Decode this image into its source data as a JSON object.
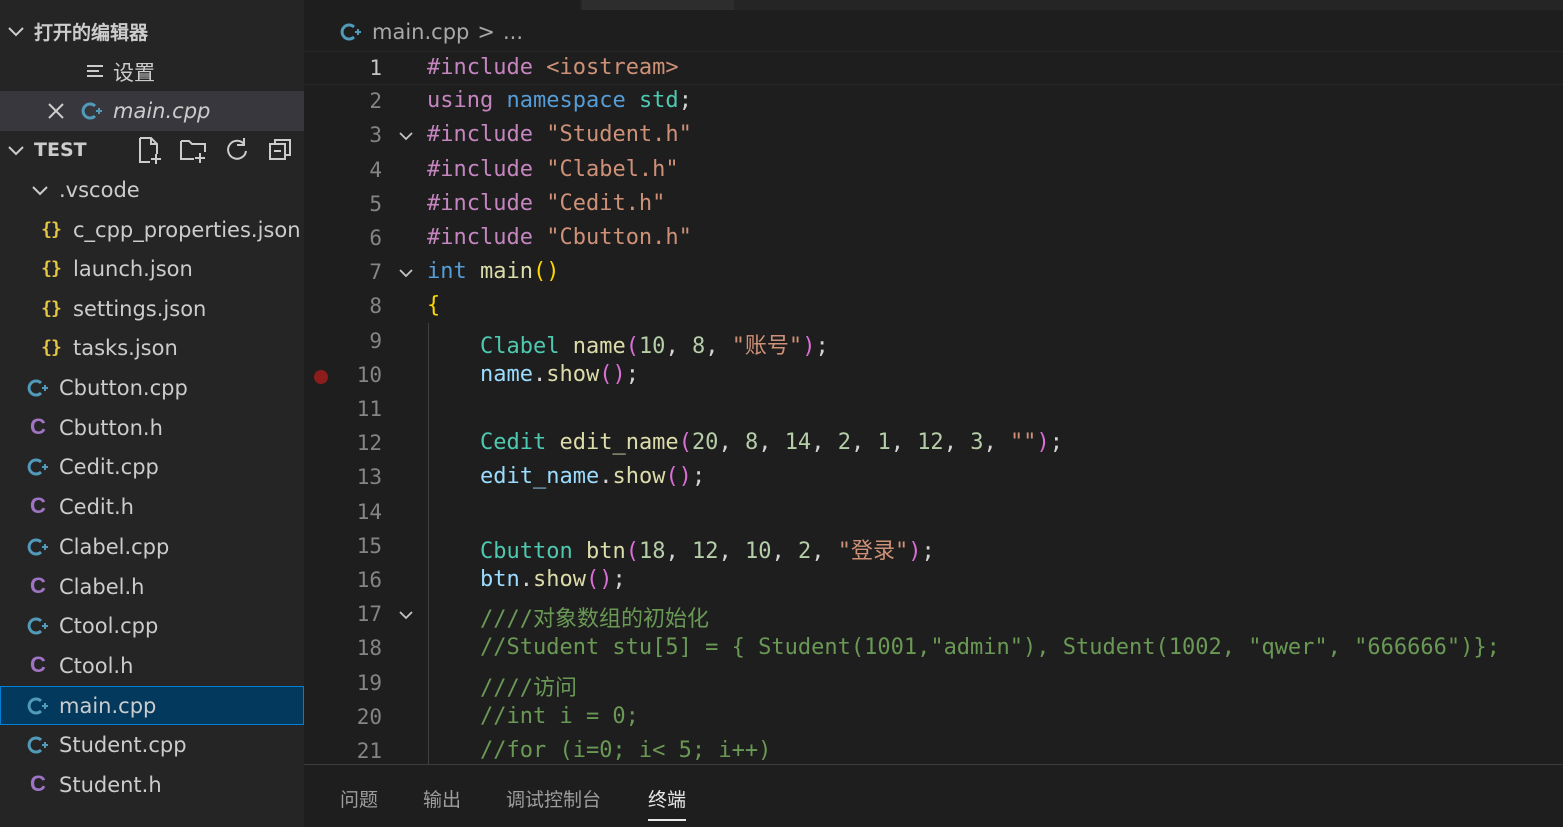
{
  "sidebar": {
    "open_editors_title": "打开的编辑器",
    "open_editors": [
      {
        "label": "设置",
        "icon": "settings-list-icon"
      },
      {
        "label": "main.cpp",
        "icon": "cpp-file-icon"
      }
    ],
    "explorer_title": "TEST",
    "folder": ".vscode",
    "folder_files": [
      {
        "label": "c_cpp_properties.json",
        "icon": "json-file-icon",
        "glyph": "{}"
      },
      {
        "label": "launch.json",
        "icon": "json-file-icon",
        "glyph": "{}"
      },
      {
        "label": "settings.json",
        "icon": "json-file-icon",
        "glyph": "{}"
      },
      {
        "label": "tasks.json",
        "icon": "json-file-icon",
        "glyph": "{}"
      }
    ],
    "files": [
      {
        "label": "Cbutton.cpp",
        "type": "cpp"
      },
      {
        "label": "Cbutton.h",
        "type": "h"
      },
      {
        "label": "Cedit.cpp",
        "type": "cpp"
      },
      {
        "label": "Cedit.h",
        "type": "h"
      },
      {
        "label": "Clabel.cpp",
        "type": "cpp"
      },
      {
        "label": "Clabel.h",
        "type": "h"
      },
      {
        "label": "Ctool.cpp",
        "type": "cpp"
      },
      {
        "label": "Ctool.h",
        "type": "h"
      },
      {
        "label": "main.cpp",
        "type": "cpp"
      },
      {
        "label": "Student.cpp",
        "type": "cpp"
      },
      {
        "label": "Student.h",
        "type": "h"
      }
    ],
    "selected_file": "main.cpp",
    "h_glyph": "C"
  },
  "editor": {
    "breadcrumb_file": "main.cpp",
    "breadcrumb_sep": ">",
    "breadcrumb_more": "...",
    "current_line": 1,
    "breakpoint_line": 10,
    "fold_lines": [
      3,
      7,
      17
    ],
    "lines": [
      {
        "n": "1",
        "tokens": [
          [
            "kw-pre",
            "#include "
          ],
          [
            "str",
            "<iostream>"
          ]
        ]
      },
      {
        "n": "2",
        "tokens": [
          [
            "kw-pre",
            "using "
          ],
          [
            "kw",
            "namespace "
          ],
          [
            "typ",
            "std"
          ],
          [
            "pl",
            ";"
          ]
        ]
      },
      {
        "n": "3",
        "tokens": [
          [
            "kw-pre",
            "#include "
          ],
          [
            "str",
            "\"Student.h\""
          ]
        ]
      },
      {
        "n": "4",
        "tokens": [
          [
            "kw-pre",
            "#include "
          ],
          [
            "str",
            "\"Clabel.h\""
          ]
        ]
      },
      {
        "n": "5",
        "tokens": [
          [
            "kw-pre",
            "#include "
          ],
          [
            "str",
            "\"Cedit.h\""
          ]
        ]
      },
      {
        "n": "6",
        "tokens": [
          [
            "kw-pre",
            "#include "
          ],
          [
            "str",
            "\"Cbutton.h\""
          ]
        ]
      },
      {
        "n": "7",
        "tokens": [
          [
            "kw",
            "int "
          ],
          [
            "fn",
            "main"
          ],
          [
            "br1",
            "()"
          ]
        ]
      },
      {
        "n": "8",
        "tokens": [
          [
            "br1",
            "{"
          ]
        ]
      },
      {
        "n": "9",
        "tokens": [
          [
            "pl",
            "    "
          ],
          [
            "typ",
            "Clabel "
          ],
          [
            "fn",
            "name"
          ],
          [
            "br2",
            "("
          ],
          [
            "num",
            "10"
          ],
          [
            "pl",
            ", "
          ],
          [
            "num",
            "8"
          ],
          [
            "pl",
            ", "
          ],
          [
            "str",
            "\"账号\""
          ],
          [
            "br2",
            ")"
          ],
          [
            "pl",
            ";"
          ]
        ]
      },
      {
        "n": "10",
        "tokens": [
          [
            "pl",
            "    "
          ],
          [
            "var",
            "name"
          ],
          [
            "pl",
            "."
          ],
          [
            "fn",
            "show"
          ],
          [
            "br2",
            "()"
          ],
          [
            "pl",
            ";"
          ]
        ]
      },
      {
        "n": "11",
        "tokens": []
      },
      {
        "n": "12",
        "tokens": [
          [
            "pl",
            "    "
          ],
          [
            "typ",
            "Cedit "
          ],
          [
            "fn",
            "edit_name"
          ],
          [
            "br2",
            "("
          ],
          [
            "num",
            "20"
          ],
          [
            "pl",
            ", "
          ],
          [
            "num",
            "8"
          ],
          [
            "pl",
            ", "
          ],
          [
            "num",
            "14"
          ],
          [
            "pl",
            ", "
          ],
          [
            "num",
            "2"
          ],
          [
            "pl",
            ", "
          ],
          [
            "num",
            "1"
          ],
          [
            "pl",
            ", "
          ],
          [
            "num",
            "12"
          ],
          [
            "pl",
            ", "
          ],
          [
            "num",
            "3"
          ],
          [
            "pl",
            ", "
          ],
          [
            "str",
            "\"\""
          ],
          [
            "br2",
            ")"
          ],
          [
            "pl",
            ";"
          ]
        ]
      },
      {
        "n": "13",
        "tokens": [
          [
            "pl",
            "    "
          ],
          [
            "var",
            "edit_name"
          ],
          [
            "pl",
            "."
          ],
          [
            "fn",
            "show"
          ],
          [
            "br2",
            "()"
          ],
          [
            "pl",
            ";"
          ]
        ]
      },
      {
        "n": "14",
        "tokens": []
      },
      {
        "n": "15",
        "tokens": [
          [
            "pl",
            "    "
          ],
          [
            "typ",
            "Cbutton "
          ],
          [
            "fn",
            "btn"
          ],
          [
            "br2",
            "("
          ],
          [
            "num",
            "18"
          ],
          [
            "pl",
            ", "
          ],
          [
            "num",
            "12"
          ],
          [
            "pl",
            ", "
          ],
          [
            "num",
            "10"
          ],
          [
            "pl",
            ", "
          ],
          [
            "num",
            "2"
          ],
          [
            "pl",
            ", "
          ],
          [
            "str",
            "\"登录\""
          ],
          [
            "br2",
            ")"
          ],
          [
            "pl",
            ";"
          ]
        ]
      },
      {
        "n": "16",
        "tokens": [
          [
            "pl",
            "    "
          ],
          [
            "var",
            "btn"
          ],
          [
            "pl",
            "."
          ],
          [
            "fn",
            "show"
          ],
          [
            "br2",
            "()"
          ],
          [
            "pl",
            ";"
          ]
        ]
      },
      {
        "n": "17",
        "tokens": [
          [
            "pl",
            "    "
          ],
          [
            "cm",
            "////对象数组的初始化"
          ]
        ]
      },
      {
        "n": "18",
        "tokens": [
          [
            "pl",
            "    "
          ],
          [
            "cm",
            "//Student stu[5] = { Student(1001,\"admin\"), Student(1002, \"qwer\", \"666666\")};"
          ]
        ]
      },
      {
        "n": "19",
        "tokens": [
          [
            "pl",
            "    "
          ],
          [
            "cm",
            "////访问"
          ]
        ]
      },
      {
        "n": "20",
        "tokens": [
          [
            "pl",
            "    "
          ],
          [
            "cm",
            "//int i = 0;"
          ]
        ]
      },
      {
        "n": "21",
        "tokens": [
          [
            "pl",
            "    "
          ],
          [
            "cm",
            "//for (i=0; i< 5; i++)"
          ]
        ]
      }
    ]
  },
  "panel": {
    "tabs": [
      {
        "label": "问题",
        "name": "tab-problems"
      },
      {
        "label": "输出",
        "name": "tab-output"
      },
      {
        "label": "调试控制台",
        "name": "tab-debug-console"
      },
      {
        "label": "终端",
        "name": "tab-terminal"
      }
    ],
    "active_tab": "终端"
  },
  "colors": {
    "json": "#e2c541",
    "header": "#a074c4",
    "cpp": "#519aba",
    "selection": "#04395e"
  }
}
